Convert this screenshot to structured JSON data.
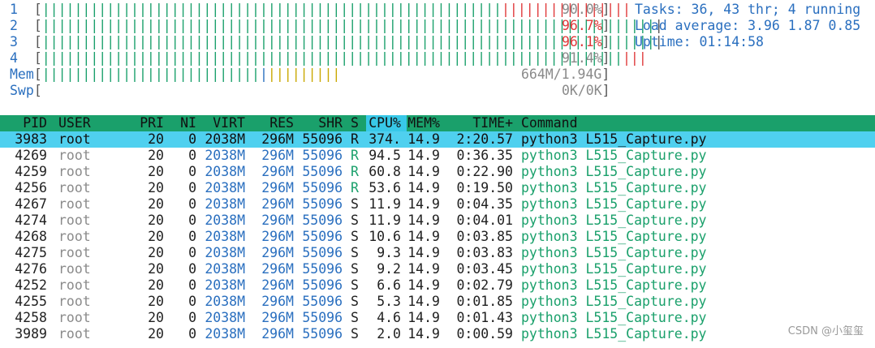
{
  "cpus": [
    {
      "label": "1",
      "green": "|||||||||||||||||||||||||||||||||||||||||||||||||||||||||",
      "red": "||||||||||||||||",
      "pct": "90.0%",
      "pct_red": false
    },
    {
      "label": "2",
      "green": "||||||||||||||||||||||||||||||||||||||||||||||||||||||||||||||||||||||||||||",
      "red": "",
      "pct": "96.7%",
      "pct_red": true
    },
    {
      "label": "3",
      "green": "||||||||||||||||||||||||||||||||||||||||||||||||||||||||||||||||||||||||||||",
      "red": "",
      "pct": "96.1%",
      "pct_red": true
    },
    {
      "label": "4",
      "green": "||||||||||||||||||||||||||||||||||||||||||||||||||||||||||||||||||||||||",
      "red": "|||",
      "pct": "91.4%",
      "pct_red": false
    }
  ],
  "mem": {
    "label": "Mem",
    "green": "|||||||||||||||||||||||||||",
    "blue": "|",
    "yellow": "|||||||||",
    "value": "664M/1.94G"
  },
  "swp": {
    "label": "Swp",
    "value": "0K/0K"
  },
  "info": {
    "tasks_label": "Tasks: ",
    "tasks": "36",
    "comma1": ", ",
    "thr": "43",
    "thr_label": " thr; ",
    "running": "4",
    "running_label": " running",
    "load_label": "Load average: ",
    "load1": "3.96",
    "load5": "1.87",
    "load15": "0.85",
    "uptime_label": "Uptime: ",
    "uptime": "01:14:58"
  },
  "columns": {
    "pid": "PID",
    "user": "USER",
    "pri": "PRI",
    "ni": "NI",
    "virt": "VIRT",
    "res": "RES",
    "shr": "SHR",
    "s": "S",
    "cpu": "CPU%",
    "mem": "MEM%",
    "time": "TIME+",
    "cmd": "Command"
  },
  "processes": [
    {
      "pid": "3983",
      "user": "root",
      "pri": "20",
      "ni": "0",
      "virt": "2038M",
      "res": "296M",
      "shr": "55096",
      "s": "R",
      "cpu": "374.",
      "mem": "14.9",
      "time": "2:20.57",
      "cmd1": "python3",
      "cmd2": "L515_Capture.py",
      "selected": true
    },
    {
      "pid": "4269",
      "user": "root",
      "pri": "20",
      "ni": "0",
      "virt": "2038M",
      "res": "296M",
      "shr": "55096",
      "s": "R",
      "cpu": "94.5",
      "mem": "14.9",
      "time": "0:36.35",
      "cmd1": "python3",
      "cmd2": "L515_Capture.py"
    },
    {
      "pid": "4259",
      "user": "root",
      "pri": "20",
      "ni": "0",
      "virt": "2038M",
      "res": "296M",
      "shr": "55096",
      "s": "R",
      "cpu": "60.8",
      "mem": "14.9",
      "time": "0:22.90",
      "cmd1": "python3",
      "cmd2": "L515_Capture.py"
    },
    {
      "pid": "4256",
      "user": "root",
      "pri": "20",
      "ni": "0",
      "virt": "2038M",
      "res": "296M",
      "shr": "55096",
      "s": "R",
      "cpu": "53.6",
      "mem": "14.9",
      "time": "0:19.50",
      "cmd1": "python3",
      "cmd2": "L515_Capture.py"
    },
    {
      "pid": "4267",
      "user": "root",
      "pri": "20",
      "ni": "0",
      "virt": "2038M",
      "res": "296M",
      "shr": "55096",
      "s": "S",
      "cpu": "11.9",
      "mem": "14.9",
      "time": "0:04.35",
      "cmd1": "python3",
      "cmd2": "L515_Capture.py"
    },
    {
      "pid": "4274",
      "user": "root",
      "pri": "20",
      "ni": "0",
      "virt": "2038M",
      "res": "296M",
      "shr": "55096",
      "s": "S",
      "cpu": "11.9",
      "mem": "14.9",
      "time": "0:04.01",
      "cmd1": "python3",
      "cmd2": "L515_Capture.py"
    },
    {
      "pid": "4268",
      "user": "root",
      "pri": "20",
      "ni": "0",
      "virt": "2038M",
      "res": "296M",
      "shr": "55096",
      "s": "S",
      "cpu": "10.6",
      "mem": "14.9",
      "time": "0:03.85",
      "cmd1": "python3",
      "cmd2": "L515_Capture.py"
    },
    {
      "pid": "4275",
      "user": "root",
      "pri": "20",
      "ni": "0",
      "virt": "2038M",
      "res": "296M",
      "shr": "55096",
      "s": "S",
      "cpu": "9.3",
      "mem": "14.9",
      "time": "0:03.83",
      "cmd1": "python3",
      "cmd2": "L515_Capture.py"
    },
    {
      "pid": "4276",
      "user": "root",
      "pri": "20",
      "ni": "0",
      "virt": "2038M",
      "res": "296M",
      "shr": "55096",
      "s": "S",
      "cpu": "9.2",
      "mem": "14.9",
      "time": "0:03.45",
      "cmd1": "python3",
      "cmd2": "L515_Capture.py"
    },
    {
      "pid": "4252",
      "user": "root",
      "pri": "20",
      "ni": "0",
      "virt": "2038M",
      "res": "296M",
      "shr": "55096",
      "s": "S",
      "cpu": "6.6",
      "mem": "14.9",
      "time": "0:02.79",
      "cmd1": "python3",
      "cmd2": "L515_Capture.py"
    },
    {
      "pid": "4255",
      "user": "root",
      "pri": "20",
      "ni": "0",
      "virt": "2038M",
      "res": "296M",
      "shr": "55096",
      "s": "S",
      "cpu": "5.3",
      "mem": "14.9",
      "time": "0:01.85",
      "cmd1": "python3",
      "cmd2": "L515_Capture.py"
    },
    {
      "pid": "4258",
      "user": "root",
      "pri": "20",
      "ni": "0",
      "virt": "2038M",
      "res": "296M",
      "shr": "55096",
      "s": "S",
      "cpu": "4.6",
      "mem": "14.9",
      "time": "0:01.43",
      "cmd1": "python3",
      "cmd2": "L515_Capture.py"
    },
    {
      "pid": "3989",
      "user": "root",
      "pri": "20",
      "ni": "0",
      "virt": "2038M",
      "res": "296M",
      "shr": "55096",
      "s": "S",
      "cpu": "2.0",
      "mem": "14.9",
      "time": "0:00.59",
      "cmd1": "python3",
      "cmd2": "L515_Capture.py"
    }
  ],
  "watermark": "CSDN @小玺玺"
}
